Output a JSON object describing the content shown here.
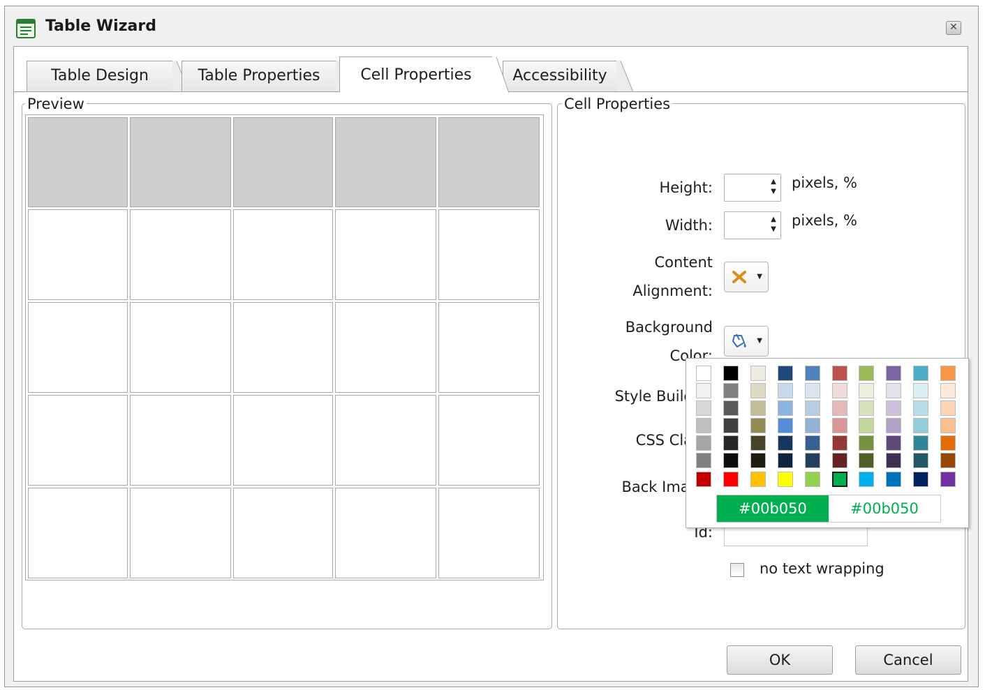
{
  "window": {
    "title": "Table Wizard",
    "close_glyph": "✕"
  },
  "tabs": [
    {
      "label": "Table Design"
    },
    {
      "label": "Table Properties"
    },
    {
      "label": "Cell Properties",
      "active": true
    },
    {
      "label": "Accessibility"
    }
  ],
  "preview": {
    "group_label": "Preview",
    "rows": 5,
    "columns": 5,
    "header_rows": 1,
    "header_color": "#cfcfcf"
  },
  "cell_properties": {
    "group_label": "Cell Properties",
    "height_label": "Height:",
    "height_value": "",
    "height_unit": "pixels, %",
    "width_label": "Width:",
    "width_value": "",
    "width_unit": "pixels, %",
    "content_alignment_label_1": "Content",
    "content_alignment_label_2": "Alignment:",
    "content_alignment_icon": "cross-icon",
    "background_color_label_1": "Background",
    "background_color_label_2": "Color:",
    "background_color_icon": "paint-bucket-icon",
    "style_builder_label": "Style Builder:",
    "css_class_label": "CSS Class:",
    "back_image_label": "Back Image:",
    "id_label": "Id:",
    "id_value": "",
    "no_text_wrapping_label": "no text wrapping",
    "no_text_wrapping_checked": false
  },
  "color_palette": {
    "selected_color": "#00b050",
    "selected_text": "#00b050",
    "columns": [
      [
        "#ffffff",
        "#f2f2f2",
        "#d8d8d8",
        "#bfbfbf",
        "#a5a5a5",
        "#7f7f7f"
      ],
      [
        "#000000",
        "#7f7f7f",
        "#595959",
        "#3f3f3f",
        "#262626",
        "#0c0c0c"
      ],
      [
        "#eeece1",
        "#ddd9c3",
        "#c4bd97",
        "#938953",
        "#494429",
        "#1d1b10"
      ],
      [
        "#1f497d",
        "#c6d9f0",
        "#8db3e2",
        "#548dd4",
        "#17365d",
        "#0f243e"
      ],
      [
        "#4f81bd",
        "#dbe5f1",
        "#b8cce4",
        "#95b3d7",
        "#366092",
        "#244061"
      ],
      [
        "#c0504d",
        "#f2dcdb",
        "#e5b9b7",
        "#d99694",
        "#953734",
        "#632423"
      ],
      [
        "#9bbb59",
        "#ebf1dd",
        "#d7e3bc",
        "#c3d69b",
        "#76923c",
        "#4f6128"
      ],
      [
        "#8064a2",
        "#e5e0ec",
        "#ccc1d9",
        "#b2a2c7",
        "#5f497a",
        "#3f3151"
      ],
      [
        "#4bacc6",
        "#dbeef3",
        "#b7dde8",
        "#92cddc",
        "#31859b",
        "#205867"
      ],
      [
        "#f79646",
        "#fdeada",
        "#fbd5b5",
        "#fac08f",
        "#e36c09",
        "#974806"
      ]
    ],
    "standard_colors": [
      "#c00000",
      "#ff0000",
      "#ffc000",
      "#ffff00",
      "#92d050",
      "#00b050",
      "#00b0f0",
      "#0070c0",
      "#002060",
      "#7030a0"
    ]
  },
  "buttons": {
    "ok": "OK",
    "cancel": "Cancel"
  }
}
